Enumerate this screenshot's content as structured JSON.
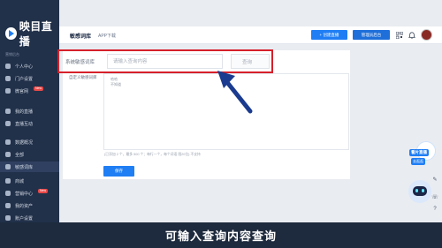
{
  "brand": {
    "name": "映目直播"
  },
  "sidebar": {
    "section": "营销后台",
    "items": [
      {
        "label": "个人中心",
        "icon": "user-icon"
      },
      {
        "label": "门户设置",
        "icon": "home-icon"
      },
      {
        "label": "微官网",
        "icon": "site-icon",
        "badge": "New"
      },
      {
        "label": "我的直播",
        "icon": "live-icon"
      },
      {
        "label": "直播互动",
        "icon": "chat-icon"
      },
      {
        "label": "数据概况",
        "icon": "chart-icon"
      },
      {
        "label": "全部",
        "icon": "list-icon"
      },
      {
        "label": "敏感词库",
        "icon": "filter-icon"
      },
      {
        "label": "商城",
        "icon": "shop-icon"
      },
      {
        "label": "营销中心",
        "icon": "gift-icon",
        "badge": "New"
      },
      {
        "label": "我的资产",
        "icon": "wallet-icon"
      },
      {
        "label": "账户设置",
        "icon": "settings-icon"
      }
    ]
  },
  "topbar": {
    "active_tab": "敏感词库",
    "app_tab": "APP下载",
    "create_button": "+ 创建直播",
    "manage_button": "管理员后台"
  },
  "main": {
    "row1_label": "系统敏感词库",
    "search_placeholder": "请输入查询内容",
    "query_button": "查询",
    "row2_label": "自定义敏感词库",
    "textarea_lines": [
      "哈哈",
      "不知道"
    ],
    "hint": "(已添加 2 个，最多 500 个；每行一个，每个词语 限20位)  不支持",
    "save_button": "保存"
  },
  "caption": "可输入查询内容查询",
  "floating": {
    "promo_tag": "看片直播",
    "promo_sub": "去逛逛"
  },
  "colors": {
    "accent": "#1f7ef4",
    "highlight": "#d6202a",
    "arrow": "#1a3b8f",
    "sidebar": "#22314a"
  }
}
